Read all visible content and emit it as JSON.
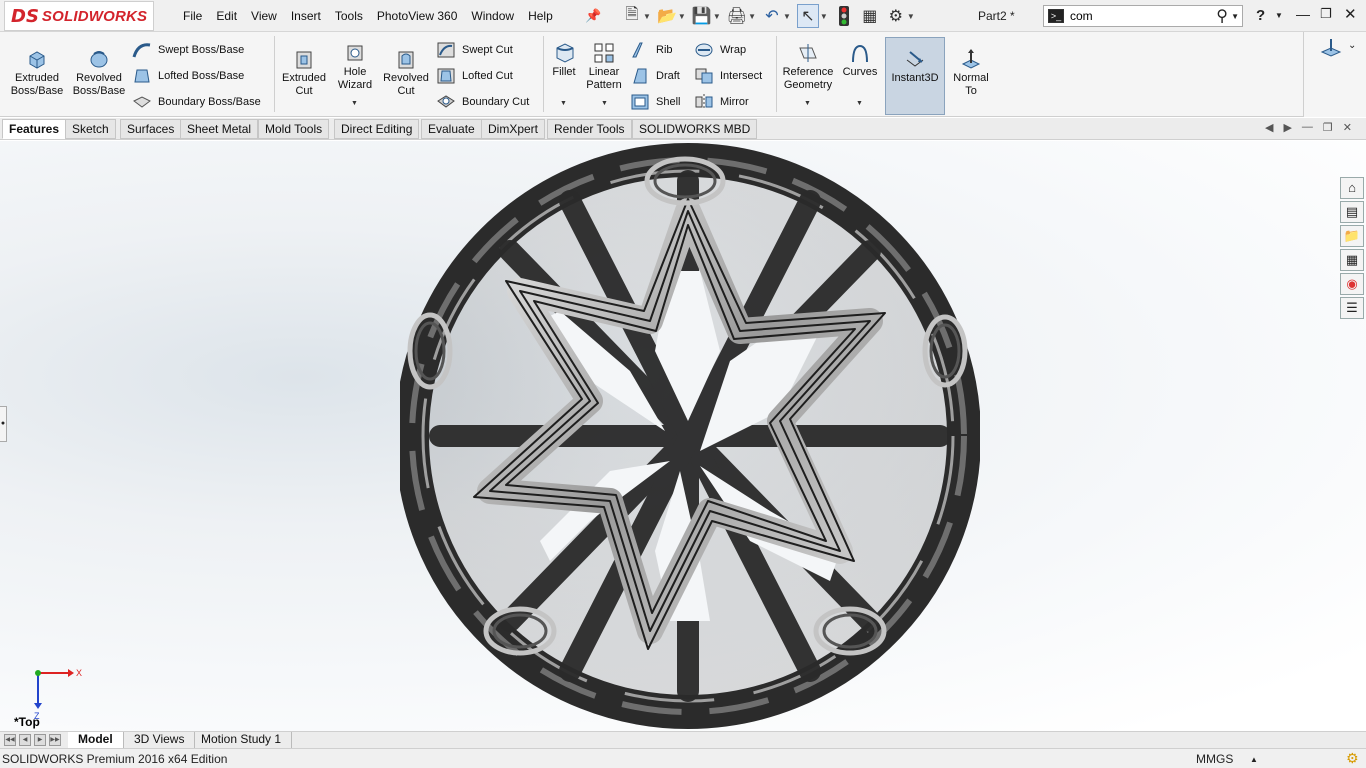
{
  "app": {
    "brand": "SOLIDWORKS",
    "logo_mark": "DS",
    "document_title": "Part2 *"
  },
  "menu": [
    "File",
    "Edit",
    "View",
    "Insert",
    "Tools",
    "PhotoView 360",
    "Window",
    "Help"
  ],
  "search": {
    "value": "com"
  },
  "command_manager": {
    "extruded_boss": "Extruded\nBoss/Base",
    "revolved_boss": "Revolved\nBoss/Base",
    "swept_boss": "Swept Boss/Base",
    "lofted_boss": "Lofted Boss/Base",
    "boundary_boss": "Boundary Boss/Base",
    "extruded_cut": "Extruded\nCut",
    "hole_wizard": "Hole\nWizard",
    "revolved_cut": "Revolved\nCut",
    "swept_cut": "Swept Cut",
    "lofted_cut": "Lofted Cut",
    "boundary_cut": "Boundary Cut",
    "fillet": "Fillet",
    "linear_pattern": "Linear\nPattern",
    "rib": "Rib",
    "draft": "Draft",
    "shell": "Shell",
    "wrap": "Wrap",
    "intersect": "Intersect",
    "mirror": "Mirror",
    "reference_geometry": "Reference\nGeometry",
    "curves": "Curves",
    "instant3d": "Instant3D",
    "normal_to": "Normal\nTo"
  },
  "tabs": [
    "Features",
    "Sketch",
    "Surfaces",
    "Sheet Metal",
    "Mold Tools",
    "Direct Editing",
    "Evaluate",
    "DimXpert",
    "Render Tools",
    "SOLIDWORKS MBD"
  ],
  "viewport": {
    "view_name": "*Top",
    "triad_x": "X",
    "triad_z": "Z"
  },
  "bottom_tabs": [
    "Model",
    "3D Views",
    "Motion Study 1"
  ],
  "status": {
    "text": "SOLIDWORKS Premium 2016 x64 Edition",
    "units": "MMGS"
  },
  "colors": {
    "brand_red": "#d3242c",
    "accent_blue": "#3a6fb0",
    "selected_tool": "#c9d5e2"
  }
}
